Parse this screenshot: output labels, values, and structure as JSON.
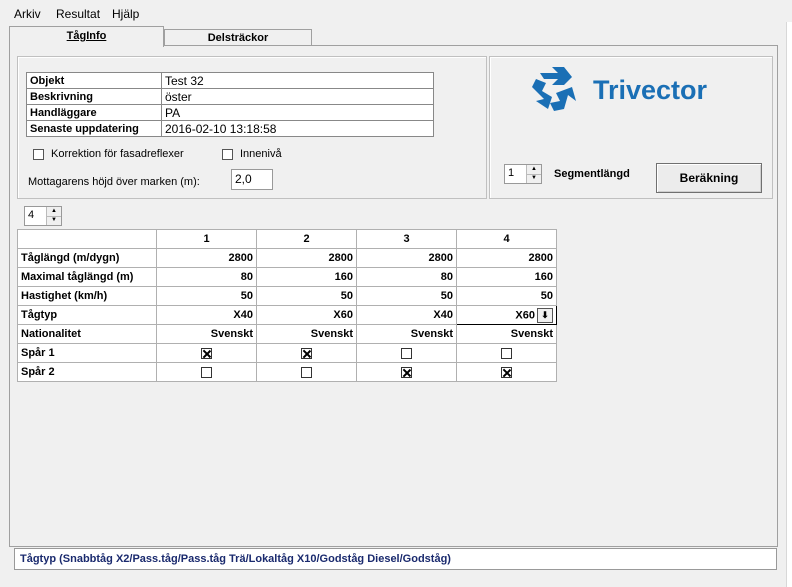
{
  "menu": [
    "Arkiv",
    "Resultat",
    "Hjälp"
  ],
  "tabs": [
    {
      "label": "TågInfo",
      "active": true
    },
    {
      "label": "Delsträckor",
      "active": false
    }
  ],
  "info": [
    {
      "label": "Objekt",
      "value": "Test 32"
    },
    {
      "label": "Beskrivning",
      "value": "öster"
    },
    {
      "label": "Handläggare",
      "value": "PA"
    },
    {
      "label": "Senaste uppdatering",
      "value": "2016-02-10 13:18:58"
    }
  ],
  "options": {
    "korrektion_label": "Korrektion för fasadreflexer",
    "korrektion_checked": false,
    "innenniva_label": "Innenivå",
    "innenniva_checked": false,
    "mottagare_label": "Mottagarens höjd över marken (m):",
    "mottagare_value": "2,0"
  },
  "logo": {
    "text": "Trivector",
    "color": "#1a6fb5"
  },
  "segment": {
    "value": "1",
    "label": "Segmentlängd"
  },
  "berakning_button": "Beräkning",
  "train_count": "4",
  "grid": {
    "columns": [
      "1",
      "2",
      "3",
      "4"
    ],
    "rows": [
      {
        "label": "Tåglängd (m/dygn)",
        "values": [
          "2800",
          "2800",
          "2800",
          "2800"
        ]
      },
      {
        "label": "Maximal tåglängd (m)",
        "values": [
          "80",
          "160",
          "80",
          "160"
        ]
      },
      {
        "label": "Hastighet (km/h)",
        "values": [
          "50",
          "50",
          "50",
          "50"
        ]
      },
      {
        "label": "Tågtyp",
        "values": [
          "X40",
          "X60",
          "X40",
          "X60"
        ]
      },
      {
        "label": "Nationalitet",
        "values": [
          "Svenskt",
          "Svenskt",
          "Svenskt",
          "Svenskt"
        ]
      }
    ],
    "spar": [
      {
        "label": "Spår 1",
        "checked": [
          true,
          true,
          false,
          false
        ]
      },
      {
        "label": "Spår 2",
        "checked": [
          false,
          false,
          true,
          true
        ]
      }
    ]
  },
  "status": "Tågtyp (Snabbtåg X2/Pass.tåg/Pass.tåg Trä/Lokaltåg X10/Godståg Diesel/Godståg)"
}
